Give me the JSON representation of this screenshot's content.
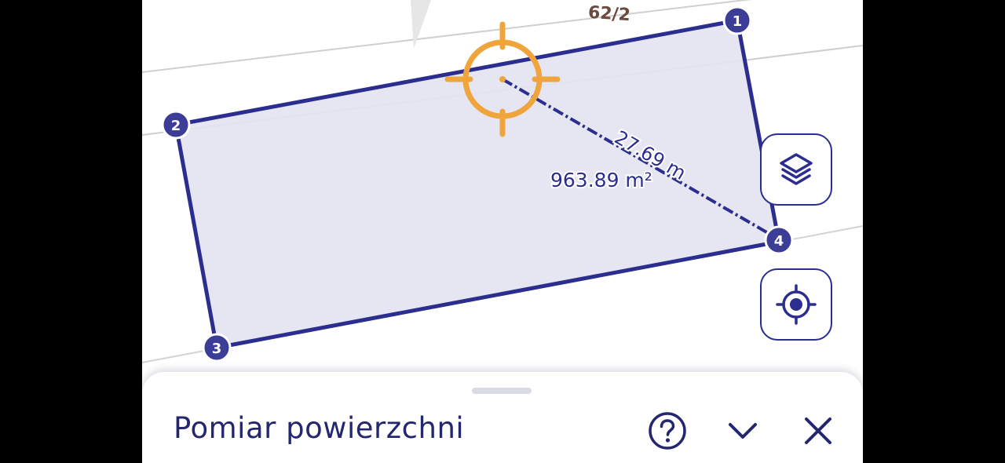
{
  "map": {
    "parcel_label": "62/2",
    "area_label": "963.89 m²",
    "distance_label": "27.69 m",
    "vertices": [
      {
        "label": "1"
      },
      {
        "label": "2"
      },
      {
        "label": "3"
      },
      {
        "label": "4"
      }
    ]
  },
  "controls": {
    "layers_icon": "layers-icon",
    "locate_icon": "my-location-icon"
  },
  "sheet": {
    "title": "Pomiar powierzchni",
    "help_icon": "help-circle-icon",
    "collapse_icon": "chevron-down-icon",
    "close_icon": "close-icon"
  },
  "colors": {
    "polygon_stroke": "#2b2d8f",
    "polygon_fill": "#e2e3f0",
    "vertex_fill": "#3b3d96",
    "crosshair": "#f0a43c",
    "text_dark": "#24266f",
    "parcel_lines": "#c9c9c9"
  }
}
